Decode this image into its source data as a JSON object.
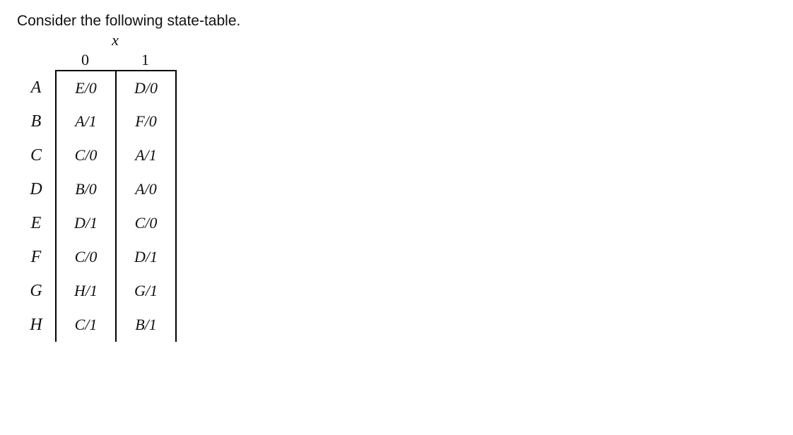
{
  "prompt": "Consider the following state-table.",
  "input_label": "x",
  "columns": [
    "0",
    "1"
  ],
  "rows": [
    {
      "state": "A",
      "c0": "E/0",
      "c1": "D/0"
    },
    {
      "state": "B",
      "c0": "A/1",
      "c1": "F/0"
    },
    {
      "state": "C",
      "c0": "C/0",
      "c1": "A/1"
    },
    {
      "state": "D",
      "c0": "B/0",
      "c1": "A/0"
    },
    {
      "state": "E",
      "c0": "D/1",
      "c1": "C/0"
    },
    {
      "state": "F",
      "c0": "C/0",
      "c1": "D/1"
    },
    {
      "state": "G",
      "c0": "H/1",
      "c1": "G/1"
    },
    {
      "state": "H",
      "c0": "C/1",
      "c1": "B/1"
    }
  ]
}
